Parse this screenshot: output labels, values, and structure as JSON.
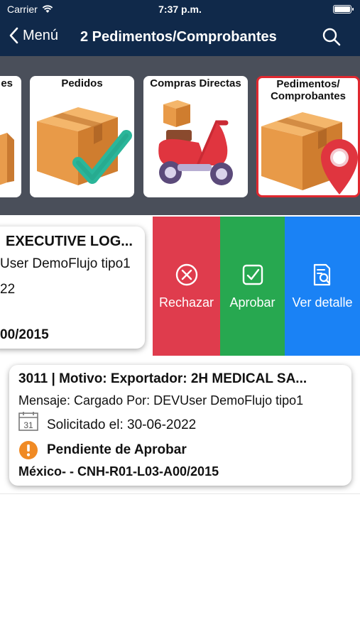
{
  "status_bar": {
    "carrier": "Carrier",
    "time": "7:37 p.m."
  },
  "navbar": {
    "back_label": "Menú",
    "title": "2 Pedimentos/Comprobantes"
  },
  "categories": [
    {
      "label": "es"
    },
    {
      "label": "Pedidos"
    },
    {
      "label": "Compras Directas"
    },
    {
      "label_line1": "Pedimentos/",
      "label_line2": "Comprobantes"
    }
  ],
  "swiped_card": {
    "title": "EXECUTIVE LOG...",
    "message": "User DemoFlujo tipo1",
    "date": "22",
    "location": "00/2015"
  },
  "actions": {
    "reject": "Rechazar",
    "approve": "Aprobar",
    "detail": "Ver detalle"
  },
  "request_card": {
    "title": "3011 | Motivo: Exportador: 2H MEDICAL SA...",
    "message": "Mensaje: Cargado Por: DEVUser DemoFlujo tipo1",
    "calendar_day": "31",
    "requested": "Solicitado el: 30-06-2022",
    "status": "Pendiente de Aprobar",
    "location": "México- - CNH-R01-L03-A00/2015"
  },
  "colors": {
    "nav": "#10294a",
    "reject": "#df3c4d",
    "approve": "#27a850",
    "detail": "#1a82f5",
    "pending": "#f08a24",
    "active_border": "#e0282f"
  }
}
